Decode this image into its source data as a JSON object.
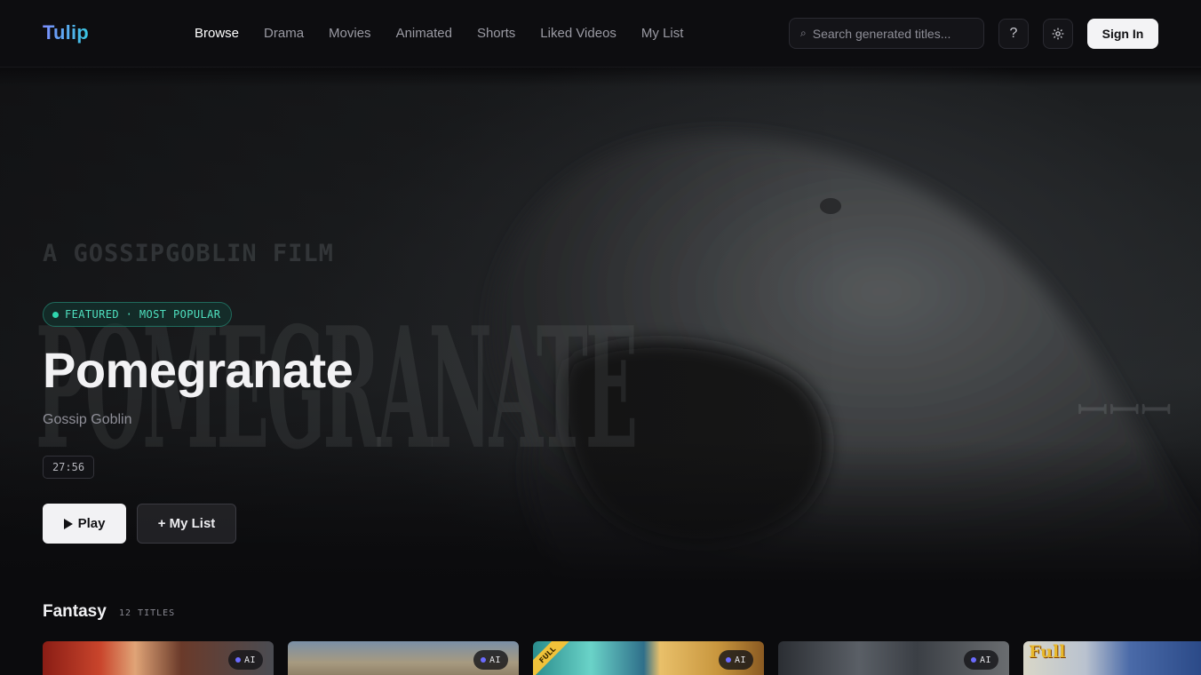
{
  "app": {
    "logo": "Tulip"
  },
  "nav": {
    "links": [
      "Browse",
      "Drama",
      "Movies",
      "Animated",
      "Shorts",
      "Liked Videos",
      "My List"
    ],
    "active": "Browse"
  },
  "search": {
    "placeholder": "Search generated titles..."
  },
  "header_actions": {
    "help_label": "?",
    "settings_icon": "gear-icon",
    "signin_label": "Sign In"
  },
  "hero": {
    "poster_tagline": "A GOSSIPGOBLIN FILM",
    "poster_title": "POMEGRANATE",
    "poster_mark": "ꟷꟷꟷ",
    "badge": "FEATURED · MOST POPULAR",
    "title": "Pomegranate",
    "creator": "Gossip Goblin",
    "duration": "27:56",
    "play_label": "Play",
    "mylist_label": "+ My List"
  },
  "row": {
    "title": "Fantasy",
    "count": "12 TITLES",
    "cards": [
      {
        "badge": "AI"
      },
      {
        "badge": "AI"
      },
      {
        "badge": "AI",
        "ribbon": "FULL"
      },
      {
        "badge": "AI"
      },
      {
        "stamp": "Full"
      }
    ]
  },
  "colors": {
    "accent": "#2fd6ae",
    "logo_start": "#7c8dff",
    "logo_end": "#38c6e0",
    "ai_dot": "#6b6bff"
  }
}
